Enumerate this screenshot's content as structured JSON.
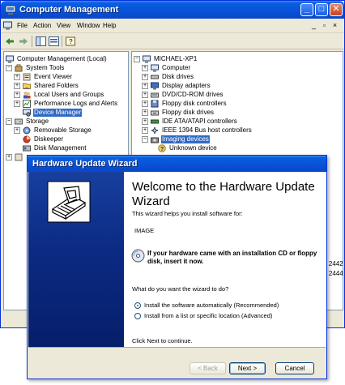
{
  "window": {
    "title": "Computer Management",
    "controls": {
      "minimize": "_",
      "maximize": "□",
      "close": "✕"
    }
  },
  "menubar": {
    "items": [
      "File",
      "Action",
      "View",
      "Window",
      "Help"
    ],
    "mdi_controls": [
      "_",
      "▫",
      "×"
    ]
  },
  "toolbar": {
    "icons": [
      "back-arrow-icon",
      "forward-arrow-icon",
      "show-tree-icon",
      "properties-icon",
      "help-icon"
    ]
  },
  "left_tree": [
    {
      "label": "Computer Management (Local)",
      "icon": "computer-management-icon"
    },
    {
      "label": "System Tools",
      "icon": "tools-icon"
    },
    {
      "label": "Event Viewer",
      "icon": "event-viewer-icon"
    },
    {
      "label": "Shared Folders",
      "icon": "shared-folders-icon"
    },
    {
      "label": "Local Users and Groups",
      "icon": "users-icon"
    },
    {
      "label": "Performance Logs and Alerts",
      "icon": "performance-icon"
    },
    {
      "label": "Device Manager",
      "icon": "device-manager-icon",
      "selected": true
    },
    {
      "label": "Storage",
      "icon": "storage-icon"
    },
    {
      "label": "Removable Storage",
      "icon": "removable-storage-icon"
    },
    {
      "label": "Diskeeper",
      "icon": "diskeeper-icon"
    },
    {
      "label": "Disk Management",
      "icon": "disk-management-icon"
    }
  ],
  "right_tree": [
    {
      "label": "MICHAEL-XP1",
      "icon": "computer-icon"
    },
    {
      "label": "Computer",
      "icon": "computer-icon"
    },
    {
      "label": "Disk drives",
      "icon": "disk-drive-icon"
    },
    {
      "label": "Display adapters",
      "icon": "display-adapter-icon"
    },
    {
      "label": "DVD/CD-ROM drives",
      "icon": "cdrom-icon"
    },
    {
      "label": "Floppy disk controllers",
      "icon": "floppy-controller-icon"
    },
    {
      "label": "Floppy disk drives",
      "icon": "floppy-drive-icon"
    },
    {
      "label": "IDE ATA/ATAPI controllers",
      "icon": "ide-controller-icon"
    },
    {
      "label": "IEEE 1394 Bus host controllers",
      "icon": "ieee1394-icon"
    },
    {
      "label": "Imaging devices",
      "icon": "imaging-device-icon",
      "selected": true
    },
    {
      "label": "Unknown device",
      "icon": "unknown-device-icon"
    }
  ],
  "right_fragments": [
    "- 2442",
    "- 2444"
  ],
  "wizard": {
    "title": "Hardware Update Wizard",
    "heading": "Welcome to the Hardware Update Wizard",
    "intro": "This wizard helps you install software for:",
    "device": "IMAGE",
    "cd_hint": "If your hardware came with an installation CD or floppy disk, insert it now.",
    "question": "What do you want the wizard to do?",
    "options": [
      {
        "label": "Install the software automatically (Recommended)",
        "selected": true
      },
      {
        "label": "Install from a list or specific location (Advanced)",
        "selected": false
      }
    ],
    "continue_text": "Click Next to continue.",
    "buttons": {
      "back": "< Back",
      "next": "Next >",
      "cancel": "Cancel"
    }
  },
  "colors": {
    "titlebar": "#0751d6",
    "selection": "#316ac5",
    "wizard_side": "#0b2a83"
  }
}
